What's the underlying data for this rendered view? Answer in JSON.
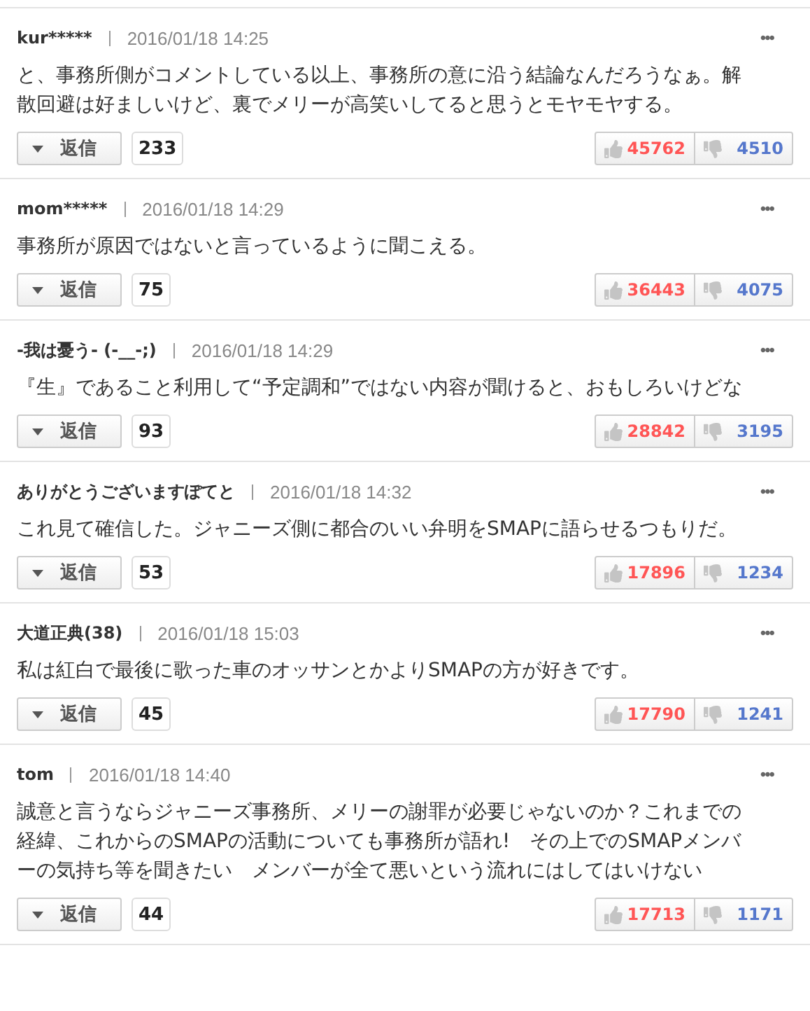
{
  "comments": [
    {
      "author": "kur*****",
      "time": "2016/01/18 14:25",
      "body": "と、事務所側がコメントしている以上、事務所の意に沿う結論なんだろうなぁ。解散回避は好ましいけど、裏でメリーが高笑いしてると思うとモヤモヤする。",
      "menu": "•••",
      "reply": "返信",
      "reply_count": "233",
      "likes": "45762",
      "dislikes": "4510"
    },
    {
      "author": "mom*****",
      "time": "2016/01/18 14:29",
      "body": "事務所が原因ではないと言っているように聞こえる。",
      "menu": "•••",
      "reply": "返信",
      "reply_count": "75",
      "likes": "36443",
      "dislikes": "4075"
    },
    {
      "author": "-我は憂う- (-__-;)",
      "time": "2016/01/18 14:29",
      "body": "『生』であること利用して“予定調和”ではない内容が聞けると、おもしろいけどな",
      "menu": "•••",
      "reply": "返信",
      "reply_count": "93",
      "likes": "28842",
      "dislikes": "3195"
    },
    {
      "author": "ありがとうございますぽてと",
      "time": "2016/01/18 14:32",
      "body": "これ見て確信した。ジャニーズ側に都合のいい弁明をSMAPに語らせるつもりだ。",
      "menu": "•••",
      "reply": "返信",
      "reply_count": "53",
      "likes": "17896",
      "dislikes": "1234"
    },
    {
      "author": "大道正典(38)",
      "time": "2016/01/18 15:03",
      "body": "私は紅白で最後に歌った車のオッサンとかよりSMAPの方が好きです。",
      "menu": "•••",
      "reply": "返信",
      "reply_count": "45",
      "likes": "17790",
      "dislikes": "1241"
    },
    {
      "author": "tom",
      "time": "2016/01/18 14:40",
      "body": "誠意と言うならジャニーズ事務所、メリーの謝罪が必要じゃないのか？これまでの経緯、これからのSMAPの活動についても事務所が語れ!　その上でのSMAPメンバーの気持ち等を聞きたい　メンバーが全て悪いという流れにはしてはいけない",
      "menu": "•••",
      "reply": "返信",
      "reply_count": "44",
      "likes": "17713",
      "dislikes": "1171"
    }
  ]
}
